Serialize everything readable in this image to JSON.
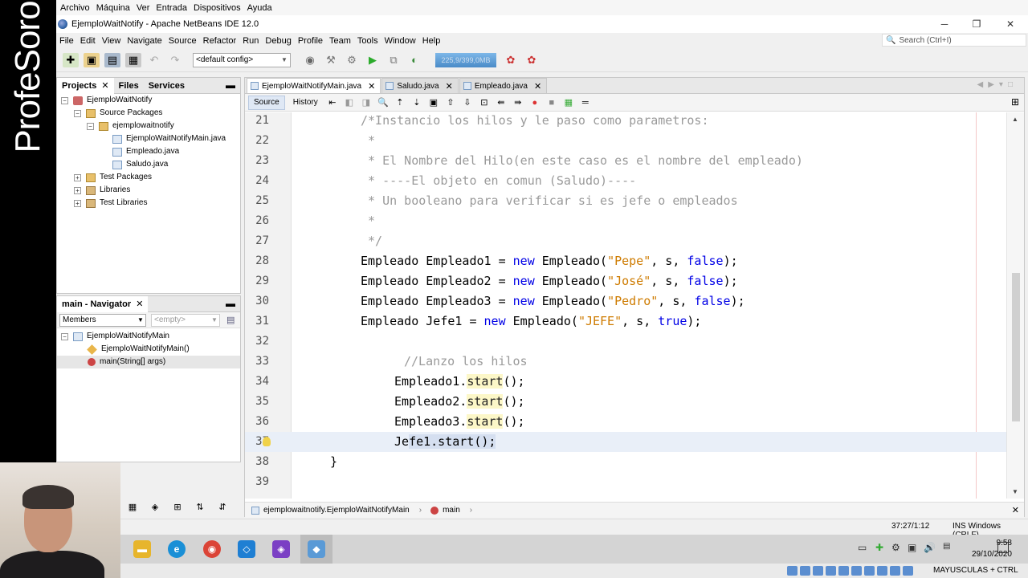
{
  "brand": {
    "text": "ProfeSoro"
  },
  "vm_menu": [
    "Archivo",
    "Máquina",
    "Ver",
    "Entrada",
    "Dispositivos",
    "Ayuda"
  ],
  "window": {
    "title": "EjemploWaitNotify - Apache NetBeans IDE 12.0"
  },
  "ide_menu": [
    "File",
    "Edit",
    "View",
    "Navigate",
    "Source",
    "Refactor",
    "Run",
    "Debug",
    "Profile",
    "Team",
    "Tools",
    "Window",
    "Help"
  ],
  "search": {
    "placeholder": "Search (Ctrl+I)"
  },
  "toolbar": {
    "config": "<default config>",
    "memory": "225,9/399,0MB"
  },
  "projects_pane": {
    "tabs": [
      "Projects",
      "Files",
      "Services"
    ],
    "tree": {
      "project": "EjemploWaitNotify",
      "source_packages": "Source Packages",
      "package": "ejemplowaitnotify",
      "files": [
        "EjemploWaitNotifyMain.java",
        "Empleado.java",
        "Saludo.java"
      ],
      "test_packages": "Test Packages",
      "libraries": "Libraries",
      "test_libraries": "Test Libraries"
    }
  },
  "navigator": {
    "title": "main - Navigator",
    "members_select": "Members",
    "filter_select": "<empty>",
    "class": "EjemploWaitNotifyMain",
    "members": [
      "EjemploWaitNotifyMain()",
      "main(String[] args)"
    ]
  },
  "editor": {
    "tabs": [
      "EjemploWaitNotifyMain.java",
      "Saludo.java",
      "Empleado.java"
    ],
    "view_tabs": [
      "Source",
      "History"
    ],
    "lines": [
      {
        "n": "21",
        "text": "/*Instancio los hilos y le paso como parametros:"
      },
      {
        "n": "22",
        "text": " *"
      },
      {
        "n": "23",
        "text": " * El Nombre del Hilo(en este caso es el nombre del empleado)"
      },
      {
        "n": "24",
        "text": " * ----El objeto en comun (Saludo)----"
      },
      {
        "n": "25",
        "text": " * Un booleano para verificar si es jefe o empleados"
      },
      {
        "n": "26",
        "text": " *"
      },
      {
        "n": "27",
        "text": " */"
      },
      {
        "n": "28",
        "a": "Empleado Empleado1 = ",
        "kw": "new",
        "b": " Empleado(",
        "s": "\"Pepe\"",
        "c": ", s, ",
        "v": "false",
        "d": ");"
      },
      {
        "n": "29",
        "a": "Empleado Empleado2 = ",
        "kw": "new",
        "b": " Empleado(",
        "s": "\"José\"",
        "c": ", s, ",
        "v": "false",
        "d": ");"
      },
      {
        "n": "30",
        "a": "Empleado Empleado3 = ",
        "kw": "new",
        "b": " Empleado(",
        "s": "\"Pedro\"",
        "c": ", s, ",
        "v": "false",
        "d": ");"
      },
      {
        "n": "31",
        "a": "Empleado Jefe1 = ",
        "kw": "new",
        "b": " Empleado(",
        "s": "\"JEFE\"",
        "c": ", s, ",
        "v": "true",
        "d": ");"
      },
      {
        "n": "32",
        "text": ""
      },
      {
        "n": "33",
        "text": "//Lanzo los hilos"
      },
      {
        "n": "34",
        "obj": "Empleado1.",
        "m": "start",
        "rest": "();"
      },
      {
        "n": "35",
        "obj": "Empleado2.",
        "m": "start",
        "rest": "();"
      },
      {
        "n": "36",
        "obj": "Empleado3.",
        "m": "start",
        "rest": "();"
      },
      {
        "n": "37",
        "pre": "Je",
        "sel": "fe1.start();",
        "post": ""
      },
      {
        "n": "38",
        "text": "}"
      },
      {
        "n": "39",
        "text": ""
      }
    ],
    "breadcrumb": [
      "ejemplowaitnotify.EjemploWaitNotifyMain",
      "main"
    ]
  },
  "status": {
    "position": "37:27/1:12",
    "mode": "INS Windows (CRLF)"
  },
  "taskbar": {
    "time": "9:58",
    "date": "29/10/2020"
  },
  "vm_status": {
    "keys": "MAYUSCULAS + CTRL"
  },
  "colors": {
    "keyword": "#0000e6",
    "string": "#ce7b00",
    "comment": "#9a9a9a",
    "memory_bar": "#4a8bc8"
  }
}
